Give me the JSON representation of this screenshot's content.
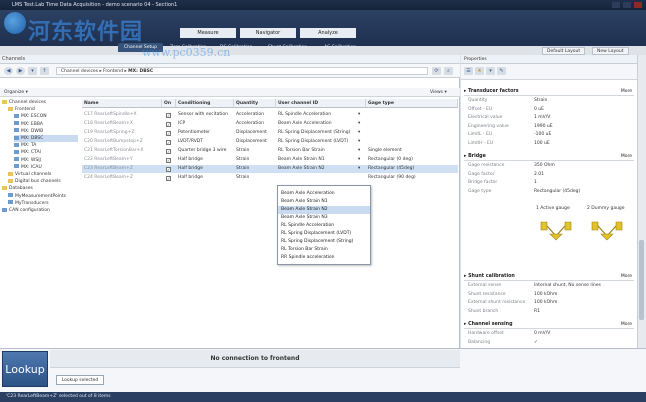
{
  "window": {
    "title": "LMS Test.Lab Time Data Acquisition - demo scenario 04 - Section1",
    "watermark": "河东软件园",
    "watermark_url": "www.pc0359.cn"
  },
  "ribbon": {
    "main_tabs": [
      {
        "label": "Measure",
        "active": false
      },
      {
        "label": "Navigator",
        "active": false
      },
      {
        "label": "Analyze",
        "active": false
      }
    ],
    "sub_tabs": [
      {
        "label": "Channel Setup",
        "active": true
      },
      {
        "label": "Zero Calibration",
        "active": false
      },
      {
        "label": "DC Calibration",
        "active": false
      },
      {
        "label": "Shunt Calibration",
        "active": false
      },
      {
        "label": "AC Calibration",
        "active": false
      }
    ],
    "layout_tabs": [
      {
        "label": "Default Layout"
      },
      {
        "label": "New Layout"
      }
    ]
  },
  "left": {
    "header": "Channels",
    "breadcrumb": [
      "Channel devices",
      "Frontend",
      "MX: DBSC"
    ],
    "organize": "Organize",
    "views": "Views",
    "tree": [
      {
        "label": "Channel devices",
        "level": 0,
        "icon": "folder"
      },
      {
        "label": "Frontend",
        "level": 1,
        "icon": "folder"
      },
      {
        "label": "MX: ESCON",
        "level": 2,
        "icon": "device"
      },
      {
        "label": "MX: EBBA",
        "level": 2,
        "icon": "device"
      },
      {
        "label": "MX: DWIB",
        "level": 2,
        "icon": "device"
      },
      {
        "label": "MX: DBSC",
        "level": 2,
        "icon": "device",
        "selected": true
      },
      {
        "label": "MX: TA",
        "level": 2,
        "icon": "device"
      },
      {
        "label": "MX: CTAI",
        "level": 2,
        "icon": "device"
      },
      {
        "label": "MX: WSIJ",
        "level": 2,
        "icon": "device"
      },
      {
        "label": "MX: ICAU",
        "level": 2,
        "icon": "device"
      },
      {
        "label": "Virtual channels",
        "level": 1,
        "icon": "folder"
      },
      {
        "label": "Digital bus channels",
        "level": 1,
        "icon": "folder"
      },
      {
        "label": "Databases",
        "level": 0,
        "icon": "folder"
      },
      {
        "label": "MyMeasurementPoints",
        "level": 1,
        "icon": "device"
      },
      {
        "label": "MyTransducers",
        "level": 1,
        "icon": "device"
      },
      {
        "label": "CAN configuration",
        "level": 0,
        "icon": "device"
      }
    ],
    "columns": [
      "Name",
      "On",
      "Conditioning",
      "Quantity",
      "User channel ID",
      "Gage type"
    ],
    "rows": [
      {
        "name": "C17 RearLeftSpindle+X",
        "on": true,
        "cond": "Sensor with excitation",
        "qty": "Acceleration",
        "uid": "RL Spindle Acceleration",
        "gage": "",
        "dim": true
      },
      {
        "name": "C18 RearLeftBeam+X",
        "on": true,
        "cond": "ICP",
        "qty": "Acceleration",
        "uid": "Beam Axle Acceleration",
        "gage": "",
        "dim": true
      },
      {
        "name": "C19 RearLeftSpring+Z",
        "on": true,
        "cond": "Potentiometer",
        "qty": "Displacement",
        "uid": "RL Spring Displacement (String)",
        "gage": "",
        "dim": true
      },
      {
        "name": "C20 RearLeftBumpstop+Z",
        "on": true,
        "cond": "LVDT/RVDT",
        "qty": "Displacement",
        "uid": "RL Spring Displacement (LVDT)",
        "gage": "",
        "dim": true
      },
      {
        "name": "C21 RearLeftTorsionBar+X",
        "on": true,
        "cond": "Quarter bridge 3 wire",
        "qty": "Strain",
        "uid": "RL Torsion Bar Strain",
        "gage": "Single element",
        "dim": true
      },
      {
        "name": "C22 RearLeftBeam+Y",
        "on": true,
        "cond": "Half bridge",
        "qty": "Strain",
        "uid": "Beam Axle Strain N1",
        "gage": "Rectangular (0 deg)",
        "dim": true
      },
      {
        "name": "C23 RearLeftBeam+Z",
        "on": true,
        "cond": "Half bridge",
        "qty": "Strain",
        "uid": "Beam Axle Strain N2",
        "gage": "Rectangular (45deg)",
        "dim": true,
        "selected": true
      },
      {
        "name": "C24 RearLeftBeam+Z",
        "on": true,
        "cond": "Half bridge",
        "qty": "Strain",
        "uid": "",
        "gage": "Rectangular (90 deg)",
        "dim": true
      }
    ],
    "dropdown_options": [
      {
        "label": "Beam Axle Acceleration"
      },
      {
        "label": "Beam Axle Strain N1"
      },
      {
        "label": "Beam Axle Strain N2",
        "selected": true
      },
      {
        "label": "Beam Axle Strain N3"
      },
      {
        "label": "RL Spindle Acceleration"
      },
      {
        "label": "RL Spring Displacement (LVDT)"
      },
      {
        "label": "RL Spring Displacement (String)"
      },
      {
        "label": "RL Torsion Bar Strain"
      },
      {
        "label": "RR Spindle acceleration"
      }
    ]
  },
  "properties": {
    "header": "Properties",
    "more": "More",
    "sections": {
      "transducer": {
        "title": "Transducer factors",
        "props": [
          {
            "k": "Quantity",
            "v": "Strain"
          },
          {
            "k": "Offset - EU",
            "v": "0 uE"
          },
          {
            "k": "Electrical value",
            "v": "1 mV/V"
          },
          {
            "k": "Engineering value",
            "v": "1990 uE"
          },
          {
            "k": "LimitL - EU",
            "v": "-100 uE"
          },
          {
            "k": "LimitH - EU",
            "v": "100 uE"
          }
        ]
      },
      "bridge": {
        "title": "Bridge",
        "props": [
          {
            "k": "Gage resistance",
            "v": "350 Ohm"
          },
          {
            "k": "Gage factor",
            "v": "2.01"
          },
          {
            "k": "Bridge factor",
            "v": "1"
          },
          {
            "k": "Gage type",
            "v": "Rectangular (45deg)"
          }
        ],
        "gauges": [
          "1 Active gauge",
          "2 Dummy gauge"
        ]
      },
      "shunt": {
        "title": "Shunt calibration",
        "props": [
          {
            "k": "External sense",
            "v": "Internal shunt, No sense lines"
          },
          {
            "k": "Shunt resistance",
            "v": "100 kOhm"
          },
          {
            "k": "External shunt resistance",
            "v": "100 kOhm"
          },
          {
            "k": "Shunt branch",
            "v": "R1"
          }
        ]
      },
      "sensing": {
        "title": "Channel sensing",
        "props": [
          {
            "k": "Hardware offset",
            "v": "0 mV/V"
          },
          {
            "k": "Balancing",
            "v": "✓"
          }
        ]
      }
    }
  },
  "bottom": {
    "lookup": "Lookup",
    "no_connection": "No connection to frontend",
    "lookup_selected": "Lookup selected"
  },
  "status": {
    "text": "'C23 RearLeftBeam+Z' selected out of 8 items"
  },
  "colors": {
    "ribbon": "#2c4163",
    "selection": "#cfe0f4",
    "gauge_yellow": "#e2c12a"
  }
}
